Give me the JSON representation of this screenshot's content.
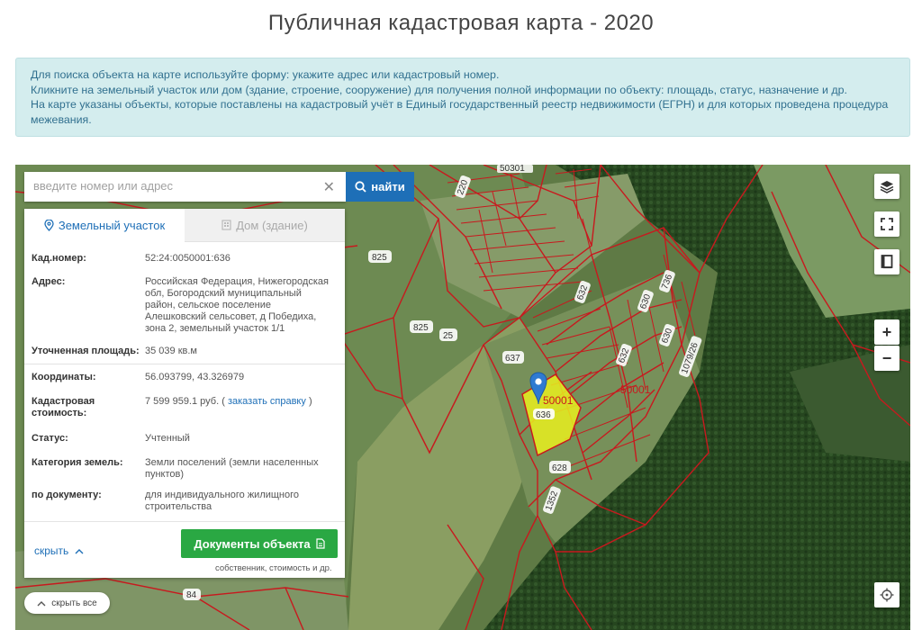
{
  "page": {
    "title": "Публичная кадастровая карта - 2020"
  },
  "info": {
    "line1": "Для поиска объекта на карте используйте форму: укажите адрес или кадастровый номер.",
    "line2": "Кликните на земельный участок или дом (здание, строение, сооружение) для получения полной информации по объекту: площадь, статус, назначение и др.",
    "line3": "На карте указаны объекты, которые поставлены на кадастровый учёт в Единый государственный реестр недвижимости (ЕГРН) и для которых проведена процедура межевания."
  },
  "search": {
    "placeholder": "введите номер или адрес",
    "value": "",
    "button_label": "найти"
  },
  "tabs": [
    {
      "label": "Земельный участок",
      "icon": "map-pin-icon",
      "active": true
    },
    {
      "label": "Дом (здание)",
      "icon": "building-icon",
      "active": false
    }
  ],
  "parcel": {
    "cad_number": {
      "label": "Кад.номер:",
      "value": "52:24:0050001:636"
    },
    "address": {
      "label": "Адрес:",
      "value": "Российская Федерация, Нижегородская обл, Богородский муниципальный район, сельское поселение Алешковский сельсовет, д Победиха, зона 2, земельный участок 1/1"
    },
    "area": {
      "label": "Уточненная площадь:",
      "value": "35 039 кв.м"
    },
    "coords": {
      "label": "Координаты:",
      "value": "56.093799, 43.326979"
    },
    "cost": {
      "label": "Кадастровая стоимость:",
      "value": "7 599 959.1 руб.",
      "link": "заказать справку",
      "open_paren": "(",
      "close_paren": ")"
    },
    "status": {
      "label": "Статус:",
      "value": "Учтенный"
    },
    "category": {
      "label": "Категория земель:",
      "value": "Земли поселений (земли населенных пунктов)"
    },
    "usage": {
      "label": "по документу:",
      "value": "для индивидуального жилищного строительства"
    }
  },
  "footer": {
    "hide_label": "скрыть",
    "docs_button": "Документы объекта",
    "docs_sub": "собственник, стоимость и др."
  },
  "map_controls": {
    "zoom_in": "+",
    "zoom_out": "−",
    "hide_all_label": "скрыть все",
    "icons": [
      "layers-icon",
      "fullscreen-icon",
      "book-icon",
      "locate-icon"
    ]
  },
  "map_labels": {
    "top": "50301",
    "l220": "220",
    "l825a": "825",
    "l825b": "825",
    "l25": "25",
    "l637": "637",
    "l632a": "632",
    "l630a": "630",
    "l736": "736",
    "l632b": "632",
    "l630b": "630",
    "l1079": "1079/26",
    "zone1": "50001",
    "zone2": "50001",
    "sel": "636",
    "l628": "628",
    "l1352": "1352",
    "l84": "84"
  },
  "colors": {
    "accent": "#1e6fb7",
    "green_button": "#2aa843",
    "parcel_line": "#c8191e",
    "selected_fill": "#e9f01e",
    "info_bg": "#d4edee"
  }
}
